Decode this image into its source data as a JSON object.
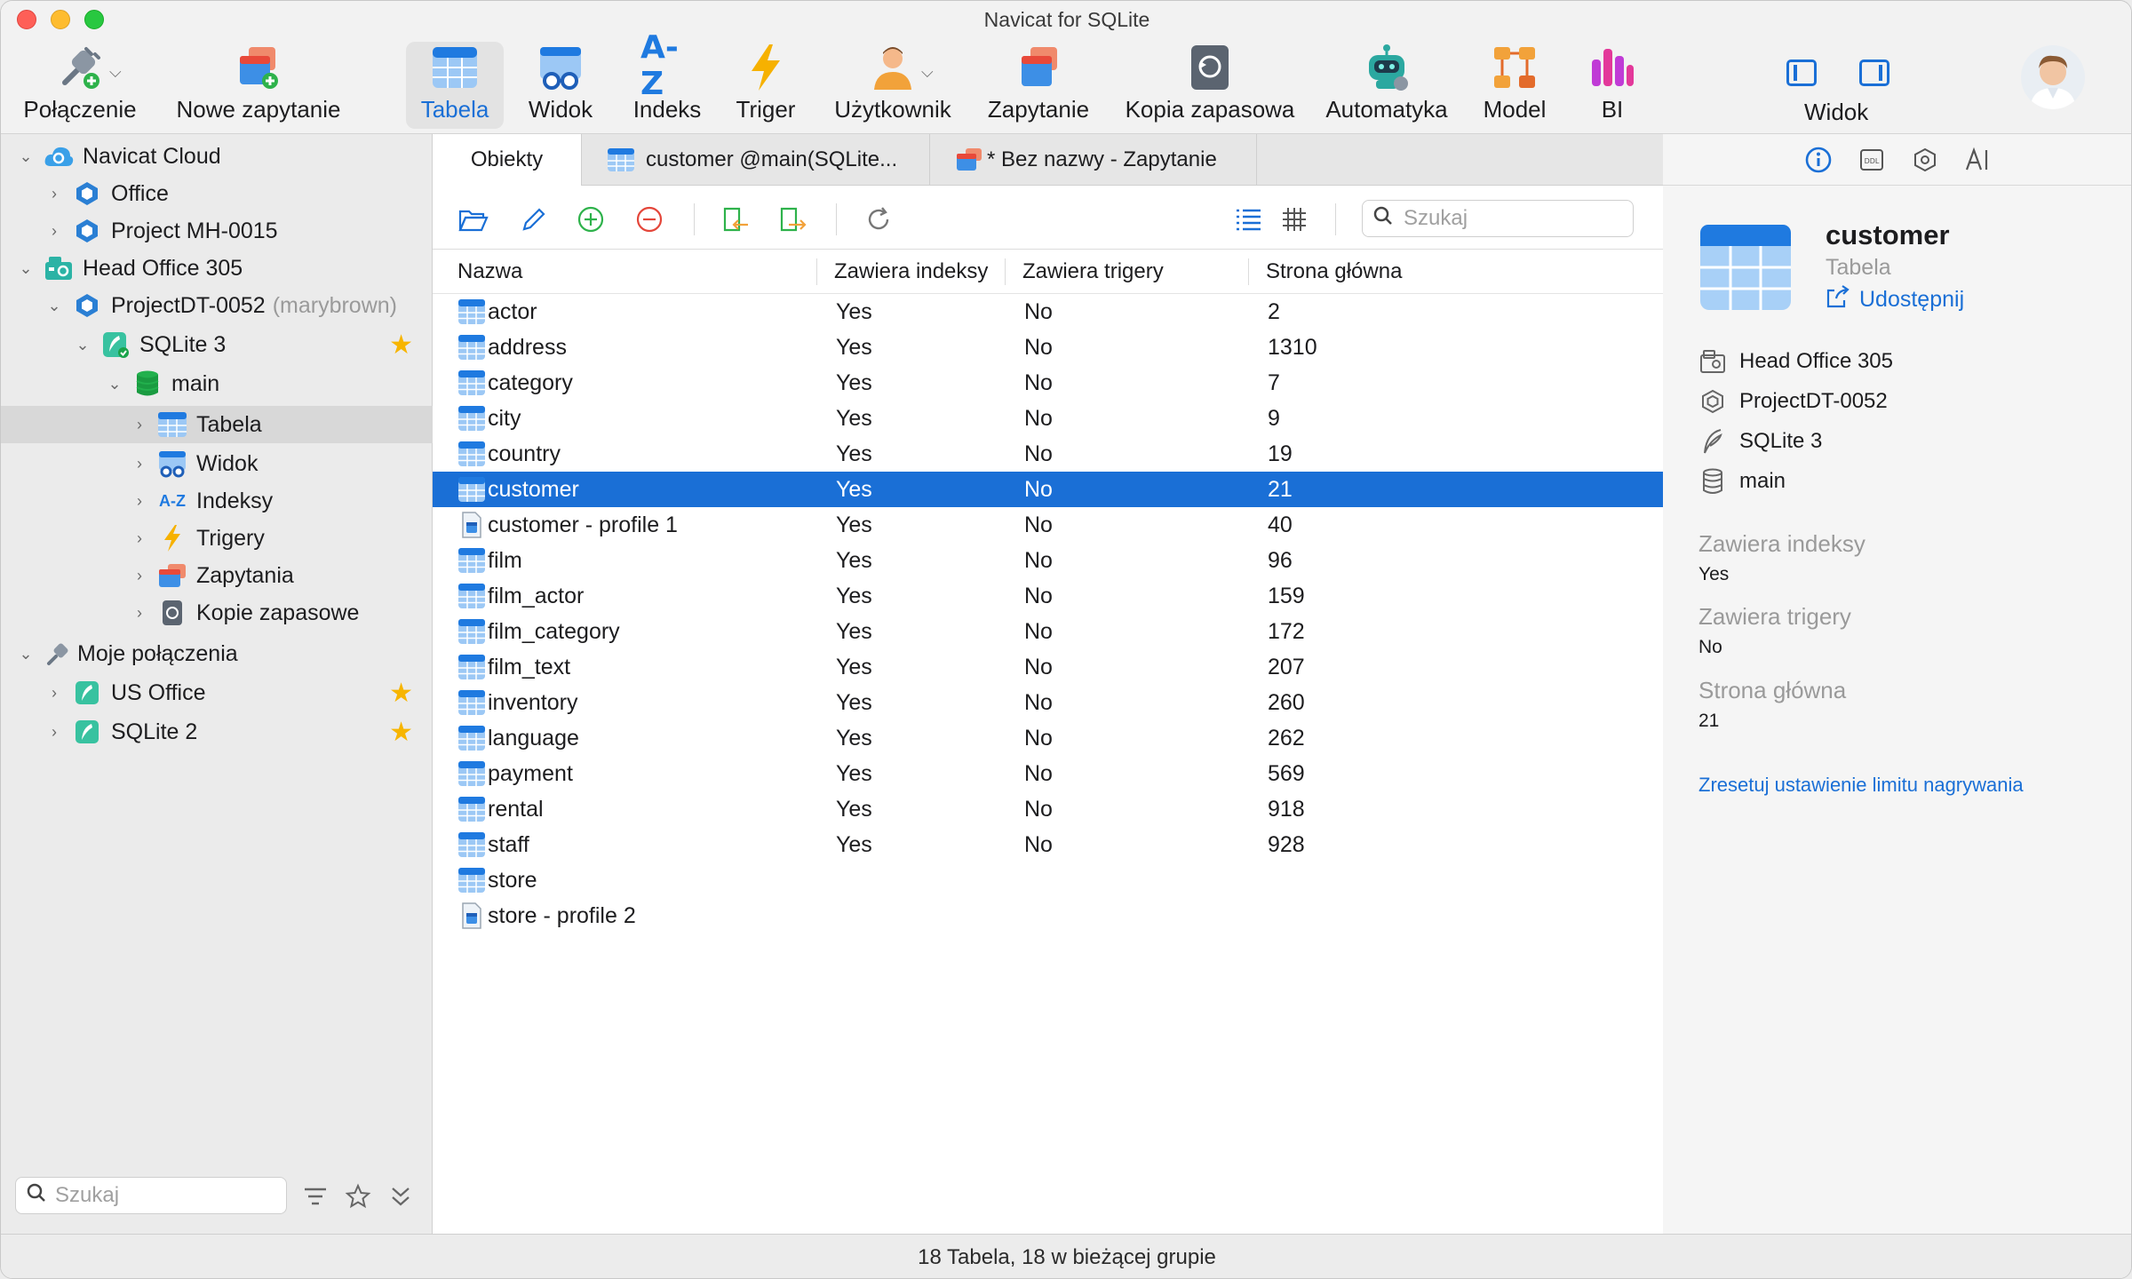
{
  "window": {
    "title": "Navicat for SQLite"
  },
  "toolbar": {
    "connection": "Połączenie",
    "new_query": "Nowe zapytanie",
    "table": "Tabela",
    "view": "Widok",
    "index": "Indeks",
    "trigger": "Triger",
    "user": "Użytkownik",
    "query": "Zapytanie",
    "backup": "Kopia zapasowa",
    "automation": "Automatyka",
    "model": "Model",
    "bi": "BI",
    "view_toggle": "Widok"
  },
  "sidebar": {
    "tree": [
      {
        "label": "Navicat Cloud"
      },
      {
        "label": "Office"
      },
      {
        "label": "Project MH-0015"
      },
      {
        "label": "Head Office 305"
      },
      {
        "label": "ProjectDT-0052",
        "sub": "(marybrown)"
      },
      {
        "label": "SQLite 3"
      },
      {
        "label": "main"
      },
      {
        "label": "Tabela"
      },
      {
        "label": "Widok"
      },
      {
        "label": "Indeksy"
      },
      {
        "label": "Trigery"
      },
      {
        "label": "Zapytania"
      },
      {
        "label": "Kopie zapasowe"
      },
      {
        "label": "Moje połączenia"
      },
      {
        "label": "US Office"
      },
      {
        "label": "SQLite 2"
      }
    ],
    "search_placeholder": "Szukaj"
  },
  "tabs": [
    {
      "label": "Obiekty"
    },
    {
      "label": "customer @main(SQLite..."
    },
    {
      "label": "* Bez nazwy - Zapytanie"
    }
  ],
  "objects": {
    "search_placeholder": "Szukaj",
    "columns": [
      "Nazwa",
      "Zawiera indeksy",
      "Zawiera trigery",
      "Strona główna"
    ],
    "rows": [
      {
        "name": "actor",
        "idx": "Yes",
        "trg": "No",
        "page": "2"
      },
      {
        "name": "address",
        "idx": "Yes",
        "trg": "No",
        "page": "1310"
      },
      {
        "name": "category",
        "idx": "Yes",
        "trg": "No",
        "page": "7"
      },
      {
        "name": "city",
        "idx": "Yes",
        "trg": "No",
        "page": "9"
      },
      {
        "name": "country",
        "idx": "Yes",
        "trg": "No",
        "page": "19"
      },
      {
        "name": "customer",
        "idx": "Yes",
        "trg": "No",
        "page": "21"
      },
      {
        "name": "customer - profile 1",
        "idx": "Yes",
        "trg": "No",
        "page": "40"
      },
      {
        "name": "film",
        "idx": "Yes",
        "trg": "No",
        "page": "96"
      },
      {
        "name": "film_actor",
        "idx": "Yes",
        "trg": "No",
        "page": "159"
      },
      {
        "name": "film_category",
        "idx": "Yes",
        "trg": "No",
        "page": "172"
      },
      {
        "name": "film_text",
        "idx": "Yes",
        "trg": "No",
        "page": "207"
      },
      {
        "name": "inventory",
        "idx": "Yes",
        "trg": "No",
        "page": "260"
      },
      {
        "name": "language",
        "idx": "Yes",
        "trg": "No",
        "page": "262"
      },
      {
        "name": "payment",
        "idx": "Yes",
        "trg": "No",
        "page": "569"
      },
      {
        "name": "rental",
        "idx": "Yes",
        "trg": "No",
        "page": "918"
      },
      {
        "name": "staff",
        "idx": "Yes",
        "trg": "No",
        "page": "928"
      },
      {
        "name": "store",
        "idx": "",
        "trg": "",
        "page": ""
      },
      {
        "name": "store - profile 2",
        "idx": "",
        "trg": "",
        "page": ""
      }
    ]
  },
  "info": {
    "name": "customer",
    "type": "Tabela",
    "share": "Udostępnij",
    "path": [
      "Head Office 305",
      "ProjectDT-0052",
      "SQLite 3",
      "main"
    ],
    "has_indexes_label": "Zawiera indeksy",
    "has_indexes_value": "Yes",
    "has_triggers_label": "Zawiera trigery",
    "has_triggers_value": "No",
    "root_page_label": "Strona główna",
    "root_page_value": "21",
    "reset_link": "Zresetuj ustawienie limitu nagrywania"
  },
  "status": {
    "text": "18 Tabela, 18 w bieżącej grupie"
  },
  "colors": {
    "accent": "#1a6fd6",
    "selection": "#1a6fd6",
    "star": "#f7b500"
  }
}
